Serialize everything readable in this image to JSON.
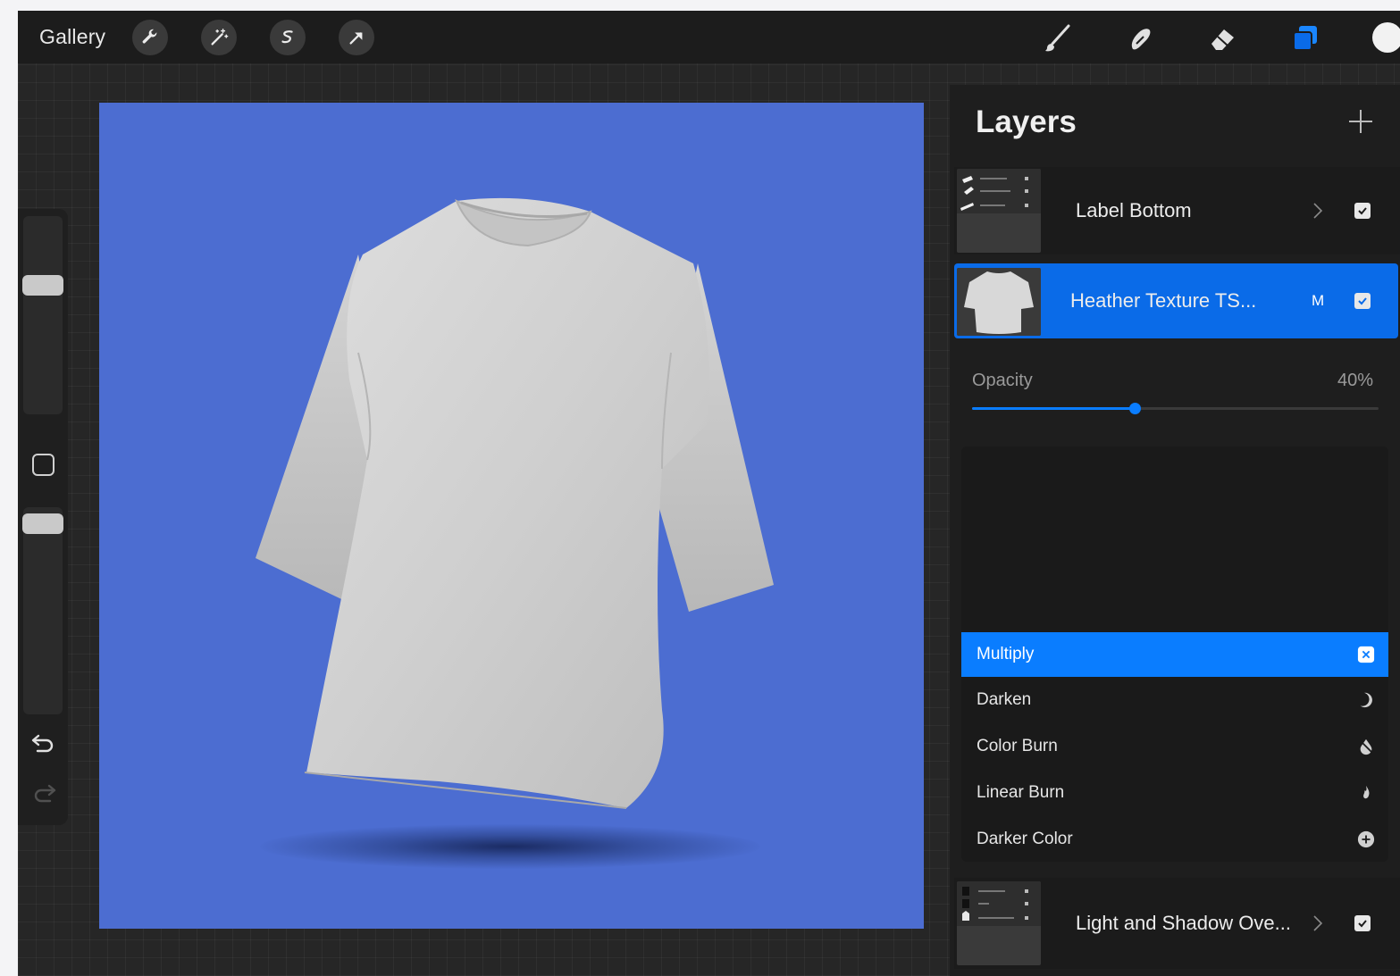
{
  "topbar": {
    "gallery_label": "Gallery",
    "left_tools": [
      "wrench-icon",
      "magic-wand-icon",
      "selection-icon",
      "transform-arrow-icon"
    ],
    "right_tools": [
      "brush-icon",
      "smudge-icon",
      "eraser-icon",
      "layers-icon",
      "color-icon"
    ],
    "accent_color": "#0a7dff",
    "current_color": "#f2f2f2"
  },
  "canvas": {
    "background_color": "#4c6dd1",
    "content": "t-shirt-mockup"
  },
  "layers_panel": {
    "title": "Layers",
    "add_icon": "plus-icon",
    "layers": [
      {
        "name": "Label Bottom",
        "type": "group",
        "visible": true
      },
      {
        "name": "Heather Texture TS...",
        "type": "layer",
        "blend_letter": "M",
        "visible": true,
        "selected": true
      },
      {
        "name": "Light and Shadow Ove...",
        "type": "group",
        "visible": true
      }
    ],
    "opacity": {
      "label": "Opacity",
      "value_text": "40%",
      "value": 0.4
    },
    "blend_modes": [
      {
        "label": "Multiply",
        "icon": "multiply-icon",
        "selected": true
      },
      {
        "label": "Darken",
        "icon": "moon-icon",
        "selected": false
      },
      {
        "label": "Color Burn",
        "icon": "burn-drop-icon",
        "selected": false
      },
      {
        "label": "Linear Burn",
        "icon": "flame-icon",
        "selected": false
      },
      {
        "label": "Darker Color",
        "icon": "plus-circle-icon",
        "selected": false
      }
    ]
  }
}
